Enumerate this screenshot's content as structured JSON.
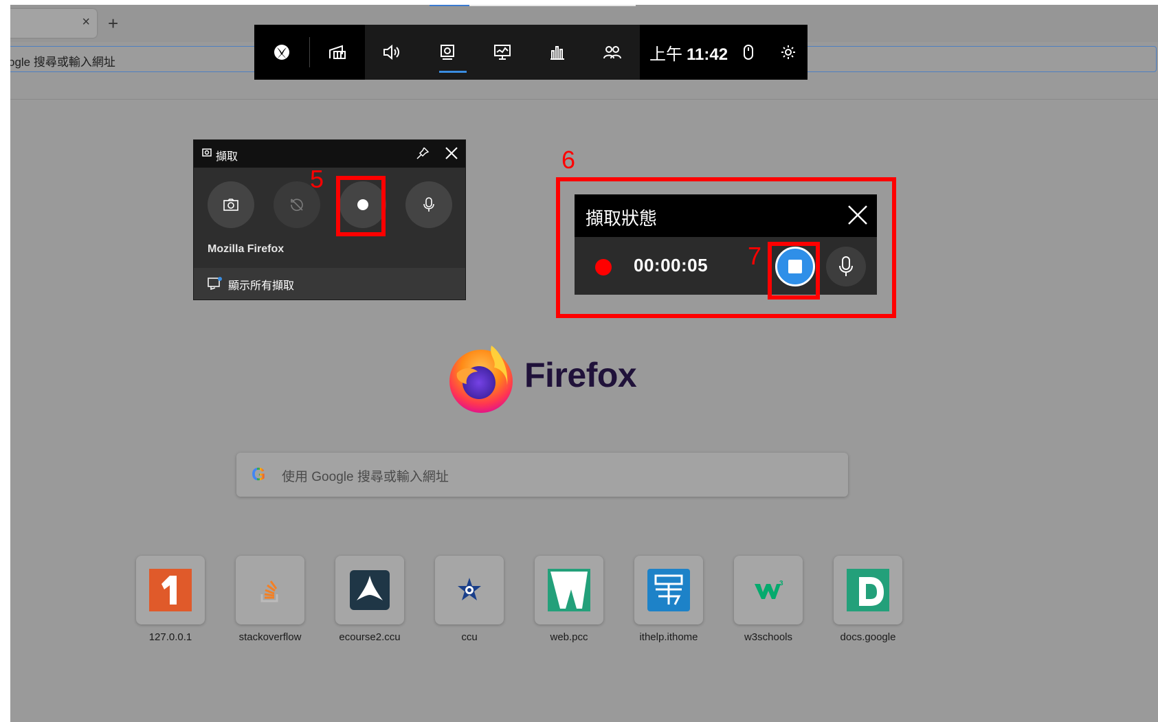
{
  "browser": {
    "tab": {
      "close_label": "×"
    },
    "new_tab_label": "+",
    "url_bar_text": "ogle 搜尋或輸入網址"
  },
  "gamebar": {
    "clock_ampm": "上午",
    "clock_time": "11:42",
    "icons": [
      "xbox-icon",
      "widget-menu-icon",
      "audio-icon",
      "capture-icon",
      "performance-icon",
      "resources-icon",
      "social-icon",
      "mouse-icon",
      "settings-icon"
    ]
  },
  "capture_widget": {
    "title": "擷取",
    "app_name": "Mozilla Firefox",
    "show_all_label": "顯示所有擷取"
  },
  "capture_status": {
    "title": "擷取狀態",
    "timer": "00:00:05"
  },
  "annotations": {
    "five": "5",
    "six": "6",
    "seven": "7"
  },
  "firefox": {
    "wordmark": "Firefox",
    "search_g": "G",
    "search_placeholder": "使用 Google 搜尋或輸入網址"
  },
  "top_sites": [
    {
      "label": "127.0.0.1"
    },
    {
      "label": "stackoverflow"
    },
    {
      "label": "ecourse2.ccu"
    },
    {
      "label": "ccu"
    },
    {
      "label": "web.pcc"
    },
    {
      "label": "ithelp.ithome"
    },
    {
      "label": "w3schools"
    },
    {
      "label": "docs.google"
    }
  ],
  "colors": {
    "accent_blue": "#3a8de0",
    "record_red": "#ff0000",
    "annotation_red": "#ff0000"
  }
}
